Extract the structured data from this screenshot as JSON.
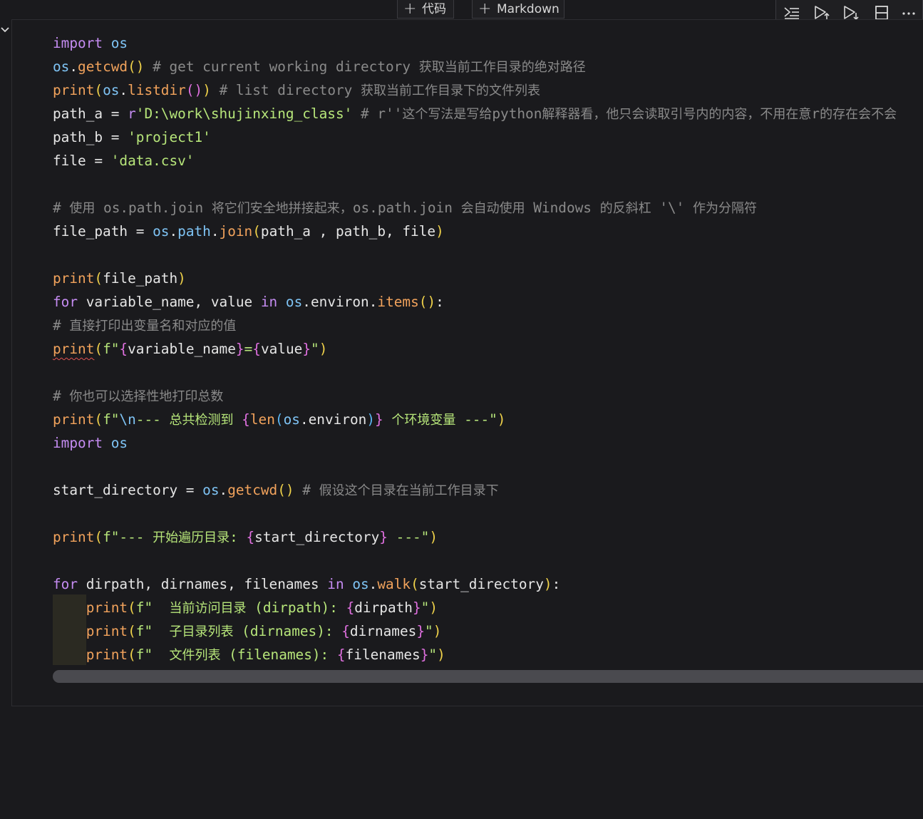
{
  "topbar": {
    "add_code_label": "代码",
    "add_markdown_label": "Markdown"
  },
  "toolbar": {
    "icons": [
      "run-by-line-icon",
      "execute-above-icon",
      "execute-below-icon",
      "split-cell-icon",
      "more-actions-icon"
    ]
  },
  "colors": {
    "background": "#1a1a1d",
    "keyword": "#c58cf2",
    "function": "#f2a35c",
    "module": "#7fc4f5",
    "string": "#b7e67a",
    "comment": "#8a8a8a",
    "plain": "#e6e6e6",
    "bracket_gold": "#f0d24a",
    "bracket_pink": "#e070e0",
    "bracket_blue": "#5cb8f5"
  },
  "code": {
    "lines": [
      [
        [
          "import",
          "k"
        ],
        [
          " ",
          "p"
        ],
        [
          "os",
          "m"
        ]
      ],
      [
        [
          "os",
          "m"
        ],
        [
          ".",
          "p"
        ],
        [
          "getcwd",
          "f"
        ],
        [
          "()",
          "bg"
        ],
        [
          " # get current working directory ",
          "c"
        ],
        [
          "获取当前工作目录的绝对路径",
          "cz"
        ]
      ],
      [
        [
          "print",
          "f"
        ],
        [
          "(",
          "bg"
        ],
        [
          "os",
          "m"
        ],
        [
          ".",
          "p"
        ],
        [
          "listdir",
          "f"
        ],
        [
          "()",
          "bp"
        ],
        [
          ")",
          "bg"
        ],
        [
          " # list directory ",
          "c"
        ],
        [
          "获取当前工作目录下的文件列表",
          "cz"
        ]
      ],
      [
        [
          "path_a = ",
          "p"
        ],
        [
          "r",
          "k"
        ],
        [
          "'D:\\work\\shujinxing_class'",
          "s"
        ],
        [
          " # r''",
          "c"
        ],
        [
          "这个写法是写给",
          "cz"
        ],
        [
          "python",
          "c"
        ],
        [
          "解释器看，他只会读取引号内的内容，不用在意",
          "cz"
        ],
        [
          "r",
          "c"
        ],
        [
          "的存在会不会",
          "cz"
        ]
      ],
      [
        [
          "path_b = ",
          "p"
        ],
        [
          "'project1'",
          "s"
        ]
      ],
      [
        [
          "file = ",
          "p"
        ],
        [
          "'data.csv'",
          "s"
        ]
      ],
      [],
      [
        [
          "# ",
          "c"
        ],
        [
          "使用",
          "cz"
        ],
        [
          " os.path.join ",
          "c"
        ],
        [
          "将它们安全地拼接起来，",
          "cz"
        ],
        [
          "os.path.join ",
          "c"
        ],
        [
          "会自动使用",
          "cz"
        ],
        [
          " Windows ",
          "c"
        ],
        [
          "的反斜杠",
          "cz"
        ],
        [
          " '\\' ",
          "c"
        ],
        [
          "作为分隔符",
          "cz"
        ]
      ],
      [
        [
          "file_path = ",
          "p"
        ],
        [
          "os",
          "m"
        ],
        [
          ".",
          "p"
        ],
        [
          "path",
          "m"
        ],
        [
          ".",
          "p"
        ],
        [
          "join",
          "f"
        ],
        [
          "(",
          "bg"
        ],
        [
          "path_a , path_b, file",
          "p"
        ],
        [
          ")",
          "bg"
        ]
      ],
      [],
      [
        [
          "print",
          "f"
        ],
        [
          "(",
          "bg"
        ],
        [
          "file_path",
          "p"
        ],
        [
          ")",
          "bg"
        ]
      ],
      [
        [
          "for",
          "k"
        ],
        [
          " variable_name, value ",
          "p"
        ],
        [
          "in",
          "k"
        ],
        [
          " ",
          "p"
        ],
        [
          "os",
          "m"
        ],
        [
          ".",
          "p"
        ],
        [
          "environ",
          "p"
        ],
        [
          ".",
          "p"
        ],
        [
          "items",
          "f"
        ],
        [
          "()",
          "bg"
        ],
        [
          ":",
          "p"
        ]
      ],
      [
        [
          "# ",
          "c"
        ],
        [
          "直接打印出变量名和对应的值",
          "cz"
        ]
      ],
      [
        [
          "print",
          "fsq"
        ],
        [
          "(",
          "bg"
        ],
        [
          "f\"",
          "s"
        ],
        [
          "{",
          "bp"
        ],
        [
          "variable_name",
          "p"
        ],
        [
          "}",
          "bp"
        ],
        [
          "=",
          "s"
        ],
        [
          "{",
          "bp"
        ],
        [
          "value",
          "p"
        ],
        [
          "}",
          "bp"
        ],
        [
          "\"",
          "s"
        ],
        [
          ")",
          "bg"
        ]
      ],
      [],
      [
        [
          "# ",
          "c"
        ],
        [
          "你也可以选择性地打印总数",
          "cz"
        ]
      ],
      [
        [
          "print",
          "f"
        ],
        [
          "(",
          "bg"
        ],
        [
          "f\"",
          "s"
        ],
        [
          "\\n",
          "m"
        ],
        [
          "--- ",
          "s"
        ],
        [
          "总共检测到",
          "sz"
        ],
        [
          " ",
          "s"
        ],
        [
          "{",
          "bp"
        ],
        [
          "len",
          "f"
        ],
        [
          "(",
          "bb"
        ],
        [
          "os",
          "m"
        ],
        [
          ".",
          "p"
        ],
        [
          "environ",
          "p"
        ],
        [
          ")",
          "bb"
        ],
        [
          "}",
          "bp"
        ],
        [
          " ",
          "s"
        ],
        [
          "个环境变量",
          "sz"
        ],
        [
          " ---\"",
          "s"
        ],
        [
          ")",
          "bg"
        ]
      ],
      [
        [
          "import",
          "k"
        ],
        [
          " ",
          "p"
        ],
        [
          "os",
          "m"
        ]
      ],
      [],
      [
        [
          "start_directory = ",
          "p"
        ],
        [
          "os",
          "m"
        ],
        [
          ".",
          "p"
        ],
        [
          "getcwd",
          "f"
        ],
        [
          "()",
          "bg"
        ],
        [
          " # ",
          "c"
        ],
        [
          "假设这个目录在当前工作目录下",
          "cz"
        ]
      ],
      [],
      [
        [
          "print",
          "f"
        ],
        [
          "(",
          "bg"
        ],
        [
          "f\"--- ",
          "s"
        ],
        [
          "开始遍历目录",
          "sz"
        ],
        [
          ": ",
          "s"
        ],
        [
          "{",
          "bp"
        ],
        [
          "start_directory",
          "p"
        ],
        [
          "}",
          "bp"
        ],
        [
          " ---\"",
          "s"
        ],
        [
          ")",
          "bg"
        ]
      ],
      [],
      [
        [
          "for",
          "k"
        ],
        [
          " dirpath, dirnames, filenames ",
          "p"
        ],
        [
          "in",
          "k"
        ],
        [
          " ",
          "p"
        ],
        [
          "os",
          "m"
        ],
        [
          ".",
          "p"
        ],
        [
          "walk",
          "f"
        ],
        [
          "(",
          "bg"
        ],
        [
          "start_directory",
          "p"
        ],
        [
          ")",
          "bg"
        ],
        [
          ":",
          "p"
        ]
      ],
      [
        [
          "    ",
          "p"
        ],
        [
          "print",
          "f"
        ],
        [
          "(",
          "bg"
        ],
        [
          "f\"  ",
          "s"
        ],
        [
          "当前访问目录",
          "sz"
        ],
        [
          " (dirpath): ",
          "s"
        ],
        [
          "{",
          "bp"
        ],
        [
          "dirpath",
          "p"
        ],
        [
          "}",
          "bp"
        ],
        [
          "\"",
          "s"
        ],
        [
          ")",
          "bg"
        ]
      ],
      [
        [
          "    ",
          "p"
        ],
        [
          "print",
          "f"
        ],
        [
          "(",
          "bg"
        ],
        [
          "f\"  ",
          "s"
        ],
        [
          "子目录列表",
          "sz"
        ],
        [
          " (dirnames): ",
          "s"
        ],
        [
          "{",
          "bp"
        ],
        [
          "dirnames",
          "p"
        ],
        [
          "}",
          "bp"
        ],
        [
          "\"",
          "s"
        ],
        [
          ")",
          "bg"
        ]
      ],
      [
        [
          "    ",
          "p"
        ],
        [
          "print",
          "f"
        ],
        [
          "(",
          "bg"
        ],
        [
          "f\"  ",
          "s"
        ],
        [
          "文件列表",
          "sz"
        ],
        [
          " (filenames): ",
          "s"
        ],
        [
          "{",
          "bp"
        ],
        [
          "filenames",
          "p"
        ],
        [
          "}",
          "bp"
        ],
        [
          "\"",
          "s"
        ],
        [
          ")",
          "bg"
        ]
      ]
    ]
  }
}
